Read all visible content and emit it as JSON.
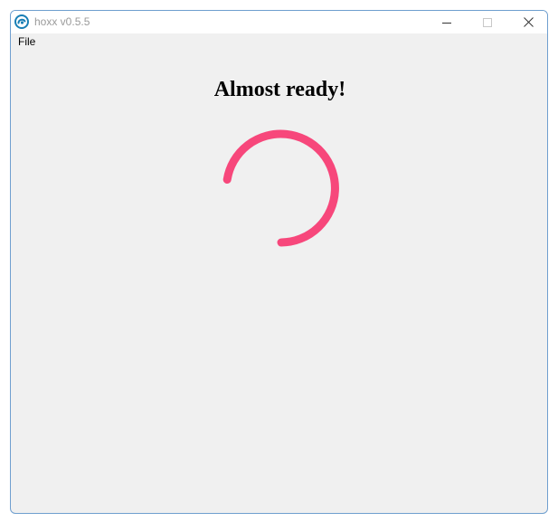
{
  "window": {
    "title": "hoxx v0.5.5",
    "app_icon": "hoxx-logo-icon",
    "controls": [
      "minimize-icon",
      "maximize-icon",
      "close-icon"
    ]
  },
  "menu": {
    "file_label": "File"
  },
  "main": {
    "heading": "Almost ready!",
    "spinner_color": "#f7477b"
  },
  "colors": {
    "window_border": "#6f9fcf",
    "background": "#f0f0f0",
    "title_text": "#9a9a9a"
  }
}
